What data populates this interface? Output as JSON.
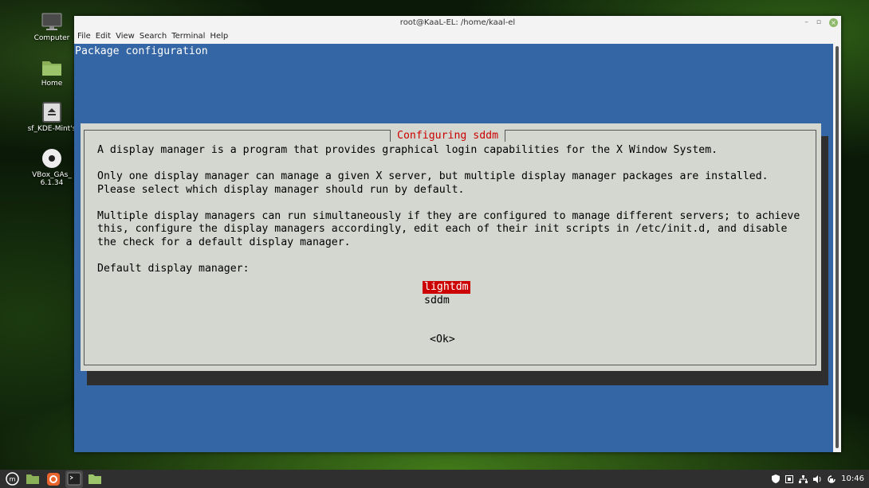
{
  "desktop": {
    "icons": [
      {
        "label": "Computer",
        "icon": "computer-icon"
      },
      {
        "label": "Home",
        "icon": "folder-icon"
      },
      {
        "label": "sf_KDE-Mint's",
        "icon": "drive-icon"
      },
      {
        "label": "VBox_GAs_\n6.1.34",
        "icon": "disc-icon"
      }
    ]
  },
  "window": {
    "title": "root@KaaL-EL: /home/kaal-el",
    "controls": {
      "minimize": "–",
      "maximize": "▫",
      "close": "×"
    },
    "menu": [
      "File",
      "Edit",
      "View",
      "Search",
      "Terminal",
      "Help"
    ]
  },
  "terminal": {
    "header": "Package configuration",
    "dialog": {
      "title": "Configuring sddm",
      "body": "A display manager is a program that provides graphical login capabilities for the X Window System.\n\nOnly one display manager can manage a given X server, but multiple display manager packages are installed.\nPlease select which display manager should run by default.\n\nMultiple display managers can run simultaneously if they are configured to manage different servers; to achieve\nthis, configure the display managers accordingly, edit each of their init scripts in /etc/init.d, and disable\nthe check for a default display manager.\n\nDefault display manager:",
      "options": [
        "lightdm",
        "sddm"
      ],
      "selected": "lightdm",
      "ok_label": "<Ok>"
    }
  },
  "taskbar": {
    "items": [
      "menu-icon",
      "files-icon",
      "firefox-icon",
      "terminal-icon",
      "folder-icon"
    ],
    "clock": "10:46"
  },
  "colors": {
    "terminal_bg": "#3465a4",
    "dialog_bg": "#d3d7cf",
    "accent_red": "#cc0000"
  }
}
